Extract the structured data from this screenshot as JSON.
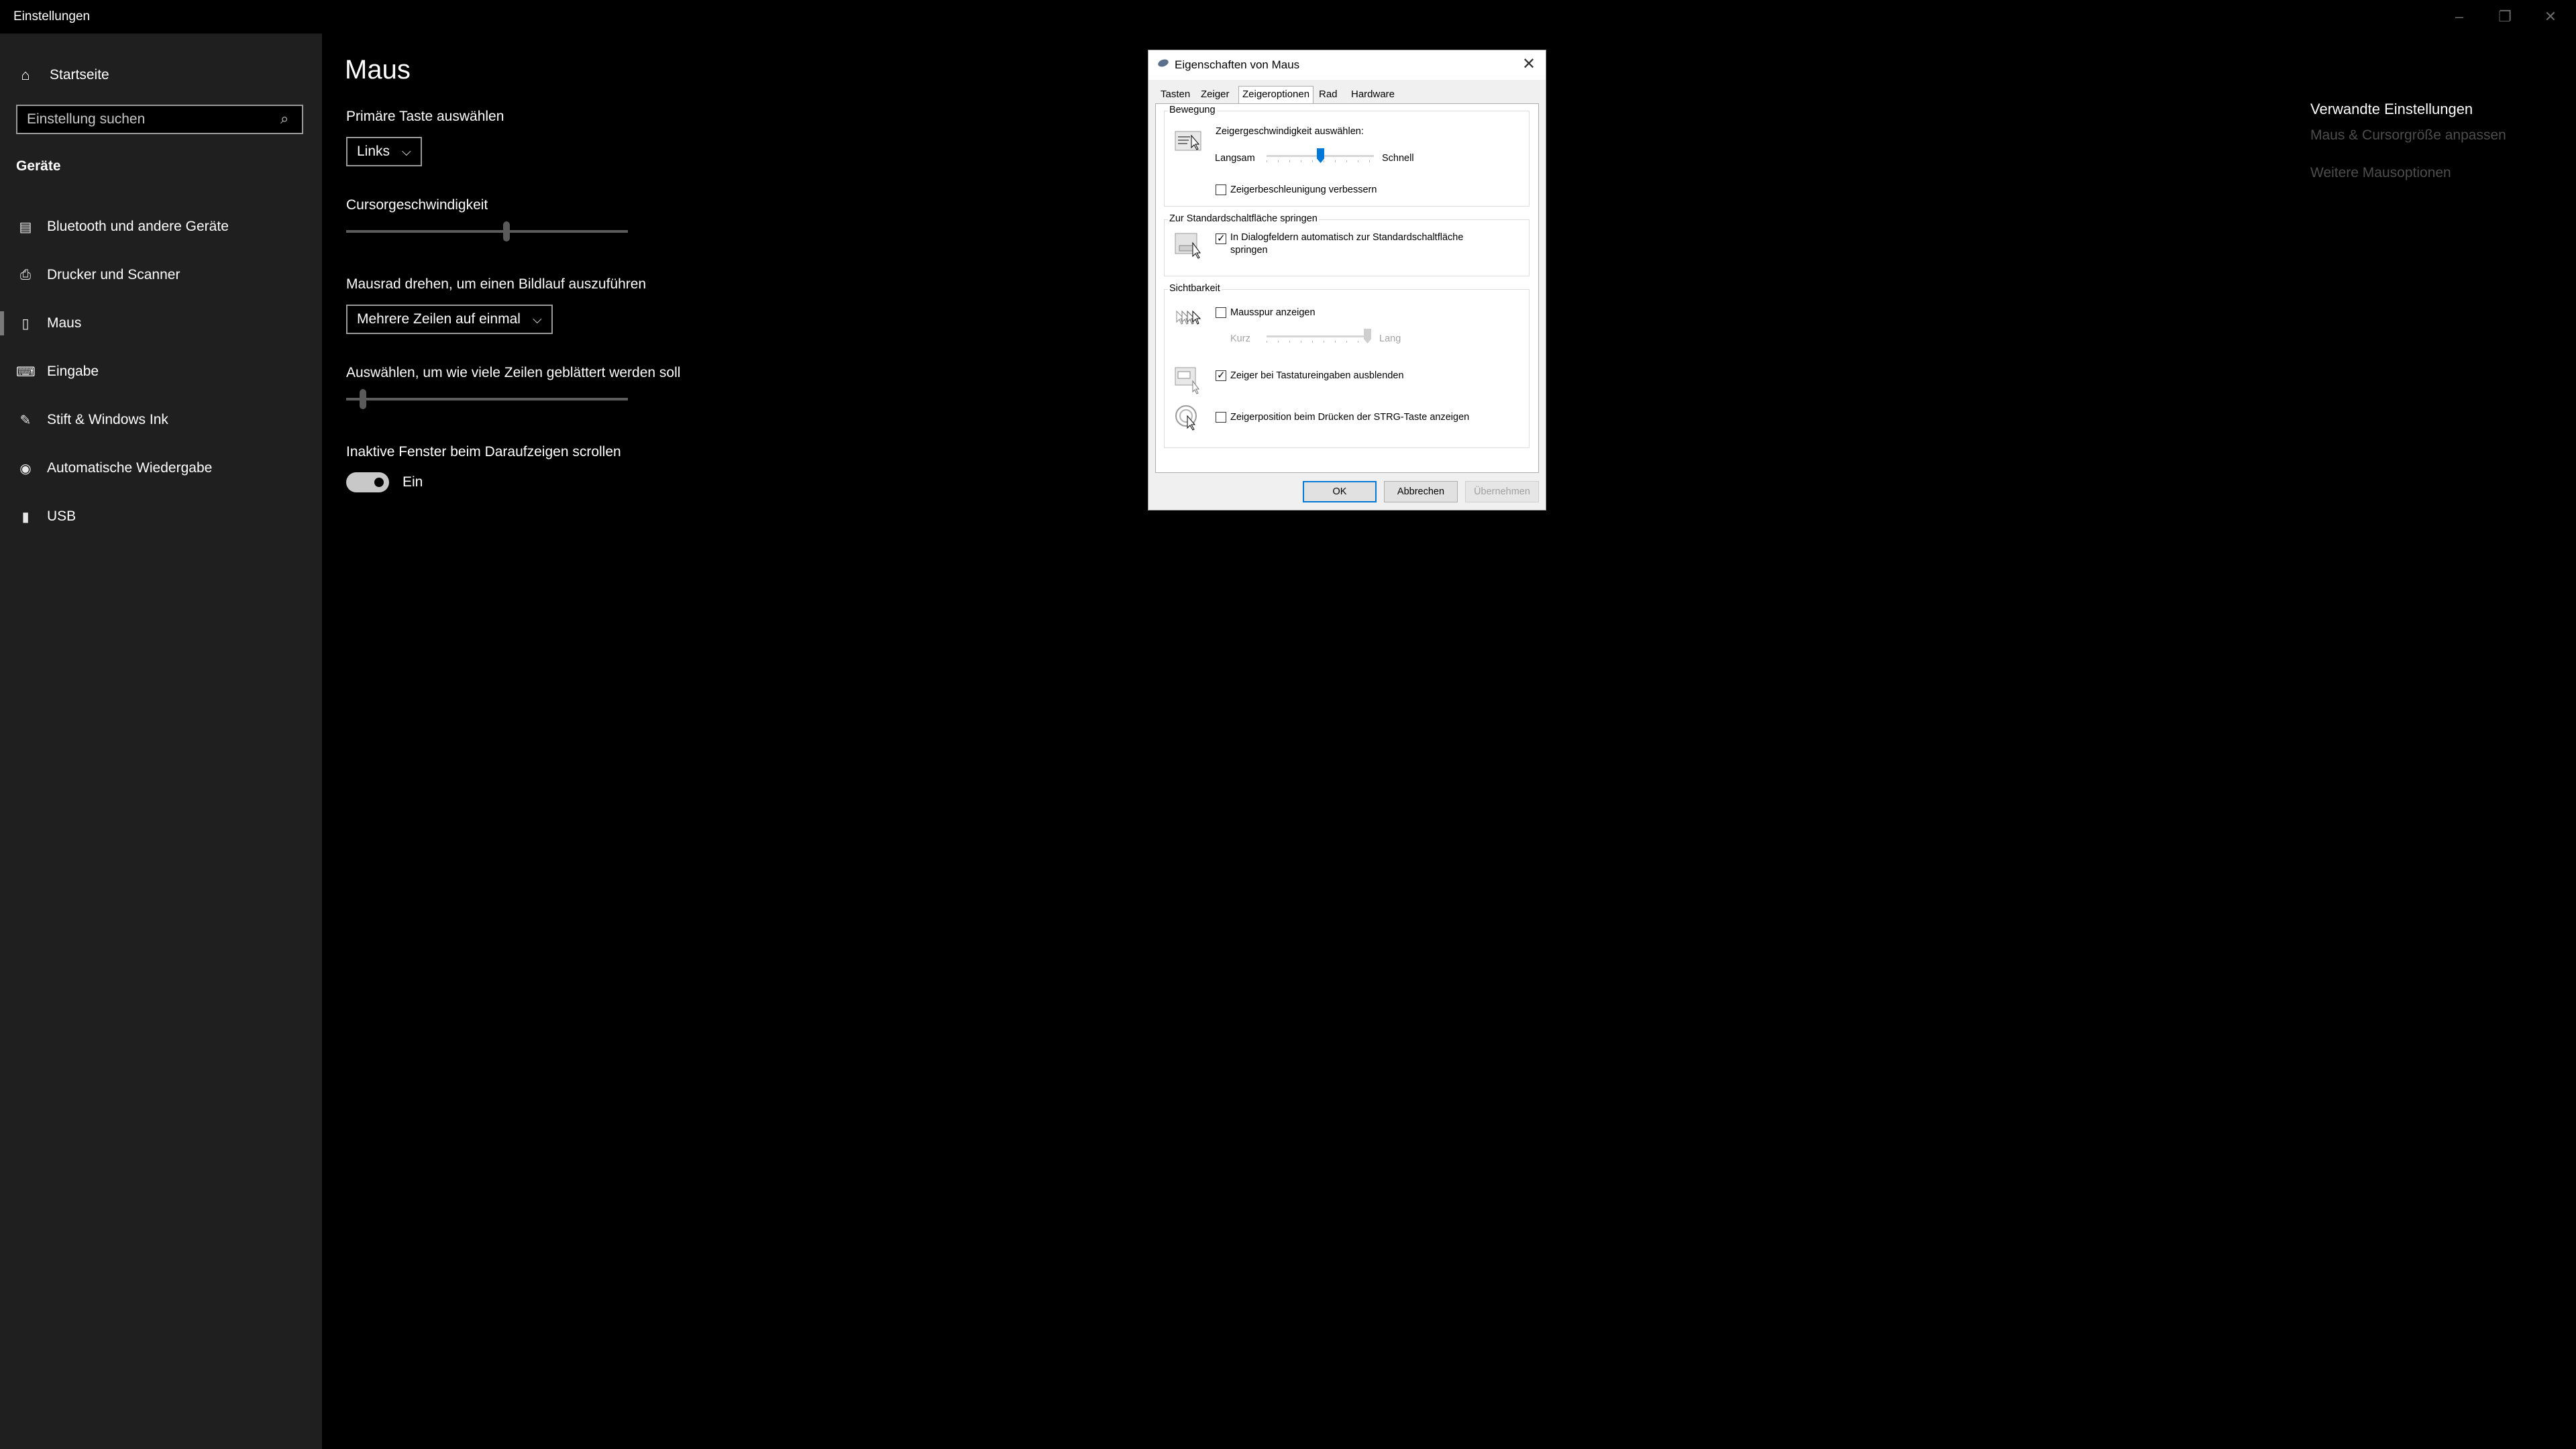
{
  "window": {
    "title": "Einstellungen",
    "minimize_icon": "–",
    "restore_icon": "❐",
    "close_icon": "✕"
  },
  "sidebar": {
    "home_label": "Startseite",
    "search_placeholder": "Einstellung suchen",
    "section_title": "Geräte",
    "items": [
      {
        "label": "Bluetooth und andere Geräte",
        "icon": "bluetooth-devices-icon"
      },
      {
        "label": "Drucker und Scanner",
        "icon": "printer-icon"
      },
      {
        "label": "Maus",
        "icon": "mouse-icon",
        "active": true
      },
      {
        "label": "Eingabe",
        "icon": "keyboard-icon"
      },
      {
        "label": "Stift & Windows Ink",
        "icon": "pen-icon"
      },
      {
        "label": "Automatische Wiedergabe",
        "icon": "autoplay-icon"
      },
      {
        "label": "USB",
        "icon": "usb-icon"
      }
    ]
  },
  "main": {
    "title": "Maus",
    "primary_button": {
      "label": "Primäre Taste auswählen",
      "value": "Links"
    },
    "cursor_speed": {
      "label": "Cursorgeschwindigkeit",
      "value_fraction": 0.57
    },
    "scroll_wheel": {
      "label": "Mausrad drehen, um einen Bildlauf auszuführen",
      "value": "Mehrere Zeilen auf einmal"
    },
    "lines_to_scroll": {
      "label": "Auswählen, um wie viele Zeilen geblättert werden soll",
      "value_fraction": 0.06
    },
    "inactive_scroll": {
      "label": "Inaktive Fenster beim Daraufzeigen scrollen",
      "state": "Ein"
    }
  },
  "related": {
    "title": "Verwandte Einstellungen",
    "links": [
      "Maus & Cursorgröße anpassen",
      "Weitere Mausoptionen"
    ]
  },
  "dialog": {
    "title": "Eigenschaften von Maus",
    "tabs": [
      "Tasten",
      "Zeiger",
      "Zeigeroptionen",
      "Rad",
      "Hardware"
    ],
    "active_tab": "Zeigeroptionen",
    "motion": {
      "title": "Bewegung",
      "speed_label": "Zeigergeschwindigkeit auswählen:",
      "slow": "Langsam",
      "fast": "Schnell",
      "speed_fraction": 0.5,
      "acceleration": {
        "label": "Zeigerbeschleunigung verbessern",
        "checked": false
      }
    },
    "snap_to": {
      "title": "Zur Standardschaltfläche springen",
      "option": {
        "label_line1": "In Dialogfeldern automatisch zur Standardschaltfläche",
        "label_line2": "springen",
        "checked": true
      }
    },
    "visibility": {
      "title": "Sichtbarkeit",
      "trails": {
        "label": "Mausspur anzeigen",
        "checked": false
      },
      "short": "Kurz",
      "long": "Lang",
      "trail_fraction": 1.0,
      "hide_while_typing": {
        "label": "Zeiger bei Tastatureingaben ausblenden",
        "checked": true
      },
      "show_location": {
        "label": "Zeigerposition beim Drücken der STRG-Taste anzeigen",
        "checked": false
      }
    },
    "buttons": {
      "ok": "OK",
      "cancel": "Abbrechen",
      "apply": "Übernehmen"
    }
  }
}
